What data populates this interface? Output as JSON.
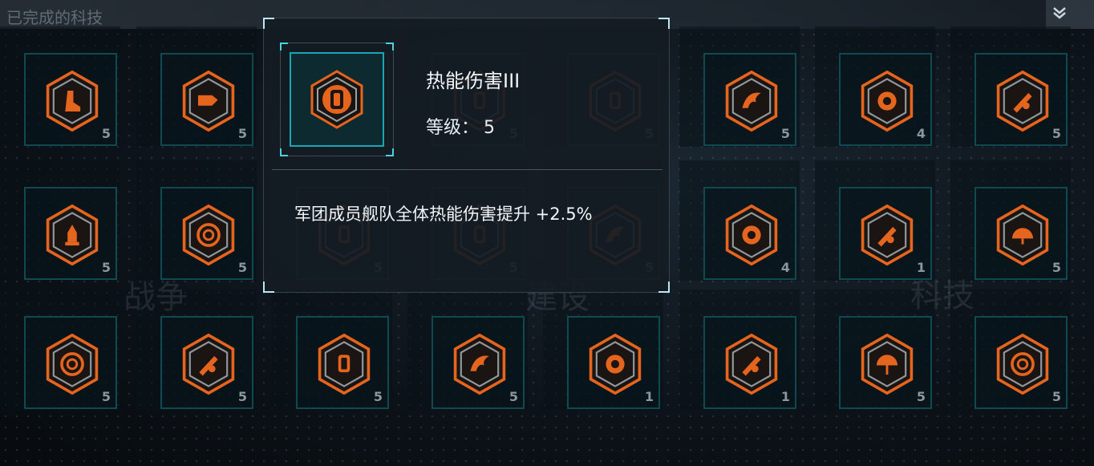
{
  "topbar": {
    "title": "已完成的科技",
    "right_icon": "chevron-down-double-icon"
  },
  "watermarks": [
    "战争",
    "建设",
    "科技"
  ],
  "colors": {
    "accent_orange": "#e5651f",
    "accent_teal": "#19a7b5",
    "panel_bg": "#141c24"
  },
  "grid": {
    "rows": [
      [
        {
          "icon": "boot-icon",
          "level": "5"
        },
        {
          "icon": "fist-icon",
          "level": "5"
        },
        {
          "icon": "shield-icon",
          "level": ""
        },
        {
          "icon": "shield-icon",
          "level": "5"
        },
        {
          "icon": "shield-icon",
          "level": "5"
        },
        {
          "icon": "flame-claw-icon",
          "level": "5"
        },
        {
          "icon": "gear-swirl-icon",
          "level": "4"
        },
        {
          "icon": "missile-icon",
          "level": "5"
        }
      ],
      [
        {
          "icon": "rocket-icon",
          "level": "5"
        },
        {
          "icon": "target-ring-icon",
          "level": "5"
        },
        {
          "icon": "shield-icon",
          "level": "5"
        },
        {
          "icon": "shield-icon",
          "level": "5"
        },
        {
          "icon": "flame-claw-icon",
          "level": "5"
        },
        {
          "icon": "gear-swirl-icon",
          "level": "4"
        },
        {
          "icon": "missile-icon",
          "level": "1"
        },
        {
          "icon": "dome-icon",
          "level": "5"
        }
      ],
      [
        {
          "icon": "target-ring-icon",
          "level": "5"
        },
        {
          "icon": "missile-icon",
          "level": "5"
        },
        {
          "icon": "shield-icon",
          "level": "5"
        },
        {
          "icon": "flame-claw-icon",
          "level": "5"
        },
        {
          "icon": "gear-swirl-icon",
          "level": "1"
        },
        {
          "icon": "missile-icon",
          "level": "1"
        },
        {
          "icon": "umbrella-icon",
          "level": "5"
        },
        {
          "icon": "target-ring-icon",
          "level": "5"
        }
      ]
    ]
  },
  "popup": {
    "title": "热能伤害III",
    "level_label": "等级：",
    "level_value": "5",
    "description": "军团成员舰队全体热能伤害提升 +2.5%",
    "icon": "thermal-damage-icon"
  }
}
